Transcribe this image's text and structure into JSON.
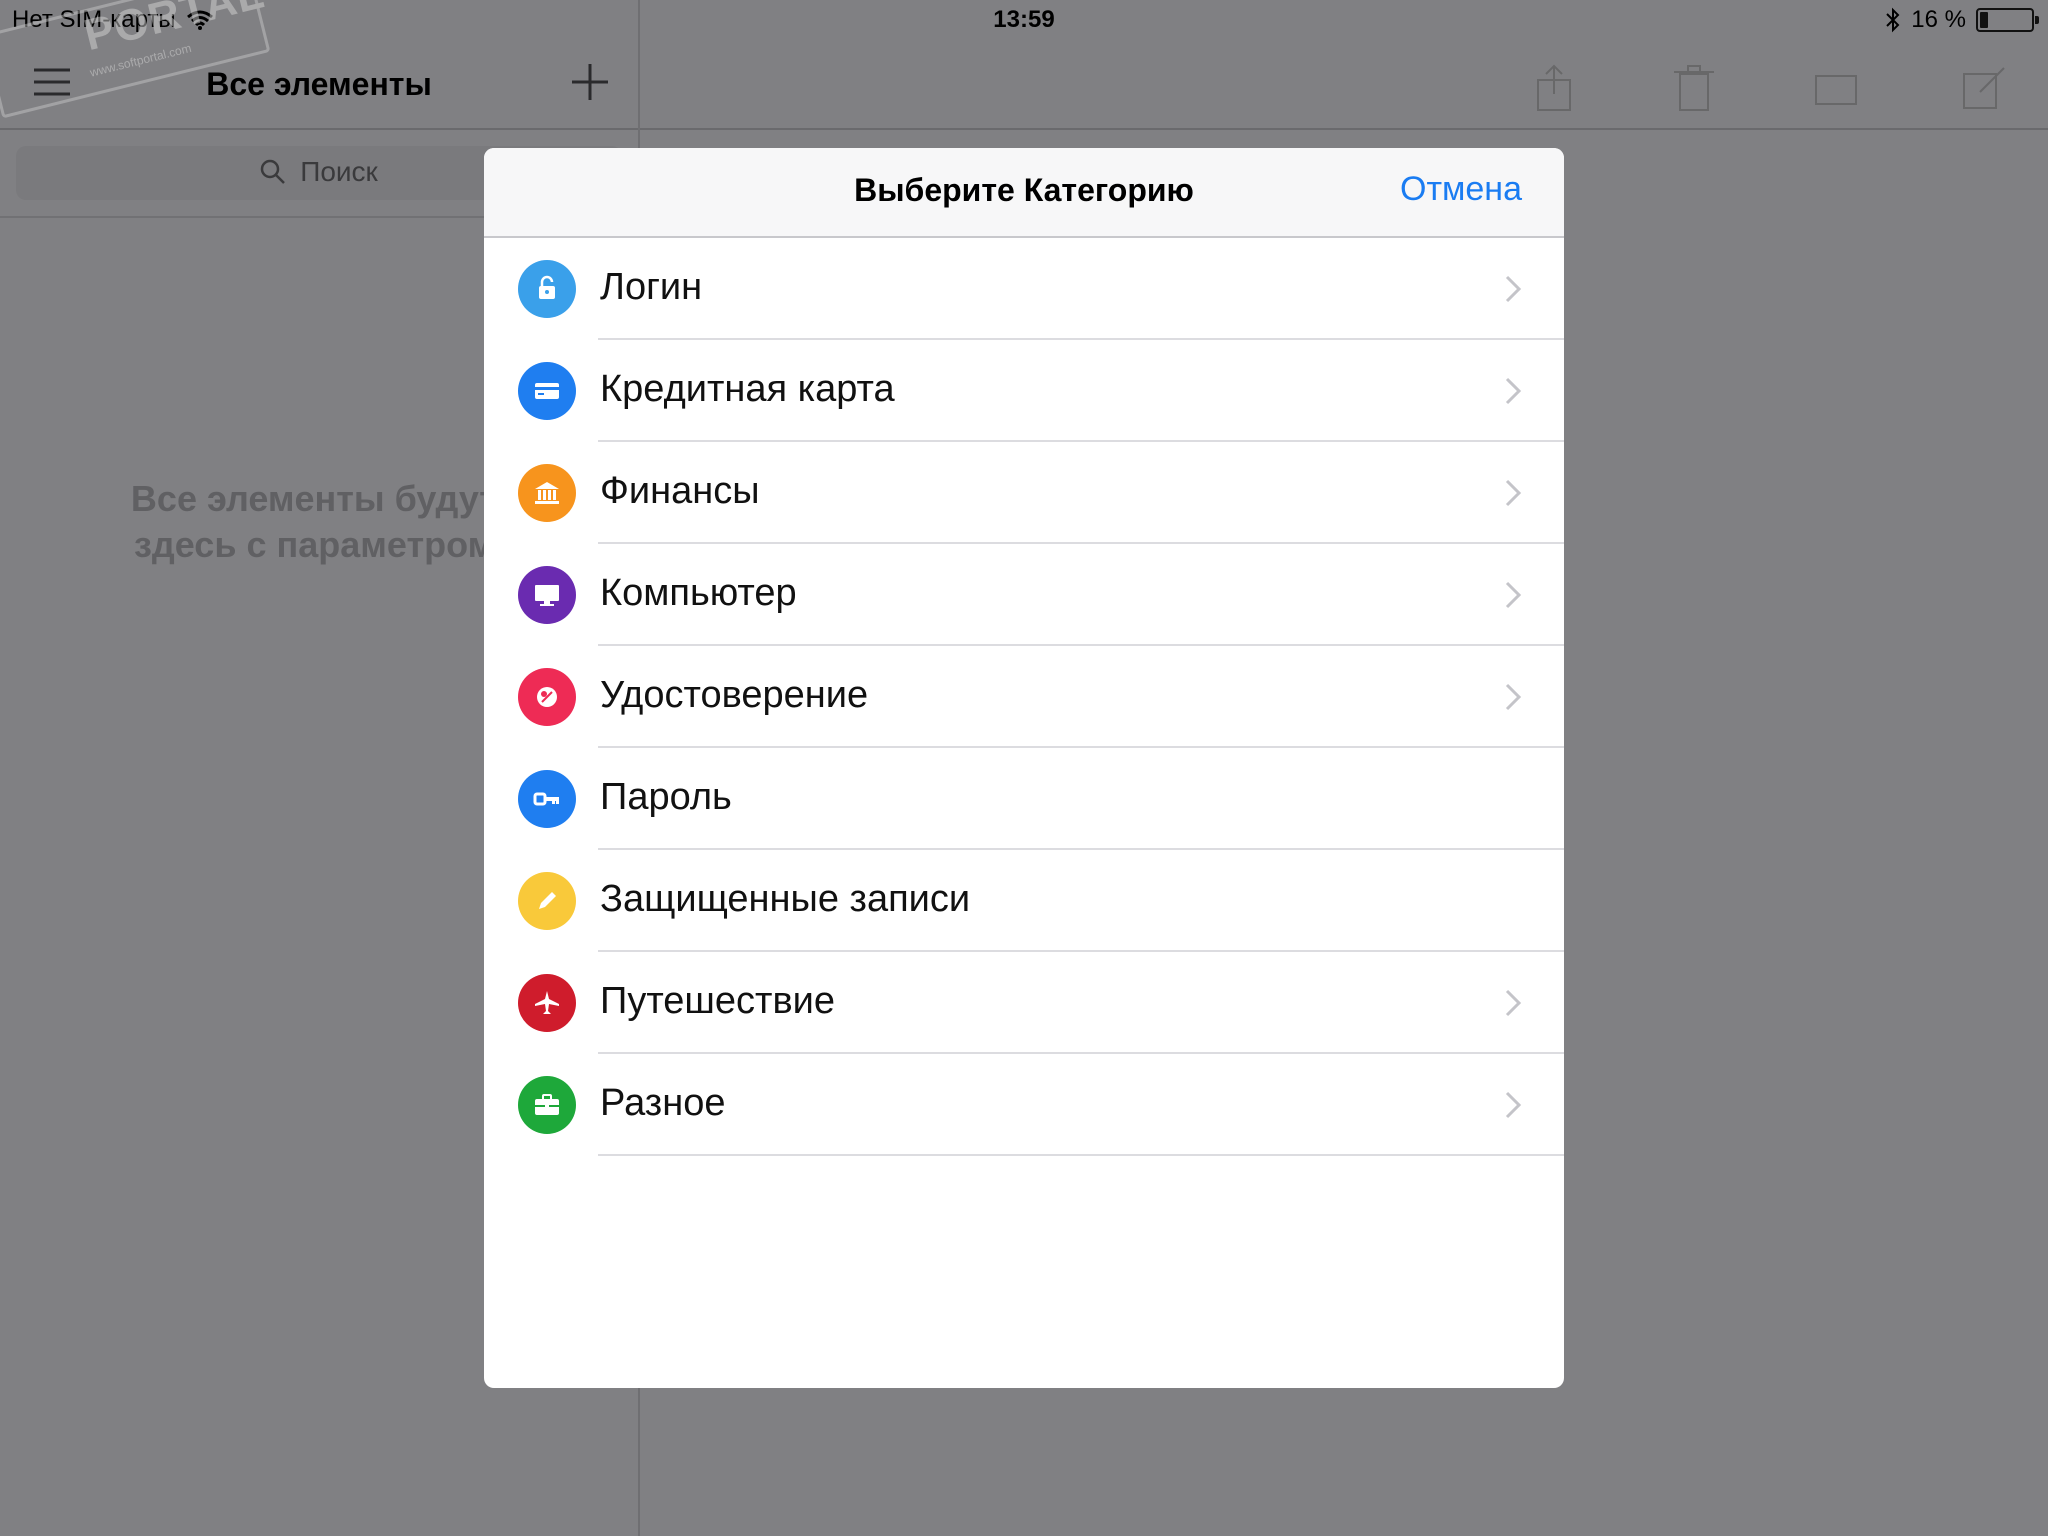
{
  "status_bar": {
    "carrier": "Нет SIM-карты",
    "time": "13:59",
    "battery_text": "16 %",
    "battery_level": 0.16
  },
  "sidebar": {
    "title": "Все элементы",
    "search_placeholder": "Поиск",
    "empty_line1": "Все элементы будут в",
    "empty_line2": "здесь с параметром п"
  },
  "watermark": {
    "brand": "PORTAL",
    "url": "www.softportal.com"
  },
  "modal": {
    "title": "Выберите Категорию",
    "cancel_label": "Отмена",
    "items": [
      {
        "label": "Логин",
        "color": "#3aa0ea",
        "icon": "lock-icon",
        "has_chevron": true
      },
      {
        "label": "Кредитная карта",
        "color": "#1f7ef0",
        "icon": "credit-card-icon",
        "has_chevron": true
      },
      {
        "label": "Финансы",
        "color": "#f7941d",
        "icon": "bank-icon",
        "has_chevron": true
      },
      {
        "label": "Компьютер",
        "color": "#6a2bb0",
        "icon": "monitor-icon",
        "has_chevron": true
      },
      {
        "label": "Удостоверение",
        "color": "#ee2b55",
        "icon": "id-badge-icon",
        "has_chevron": true
      },
      {
        "label": "Пароль",
        "color": "#1f7ef0",
        "icon": "key-icon",
        "has_chevron": false
      },
      {
        "label": "Защищенные записи",
        "color": "#f9c93a",
        "icon": "pencil-icon",
        "has_chevron": false
      },
      {
        "label": "Путешествие",
        "color": "#cf1c2c",
        "icon": "airplane-icon",
        "has_chevron": true
      },
      {
        "label": "Разное",
        "color": "#1ea83a",
        "icon": "briefcase-icon",
        "has_chevron": true
      }
    ]
  }
}
